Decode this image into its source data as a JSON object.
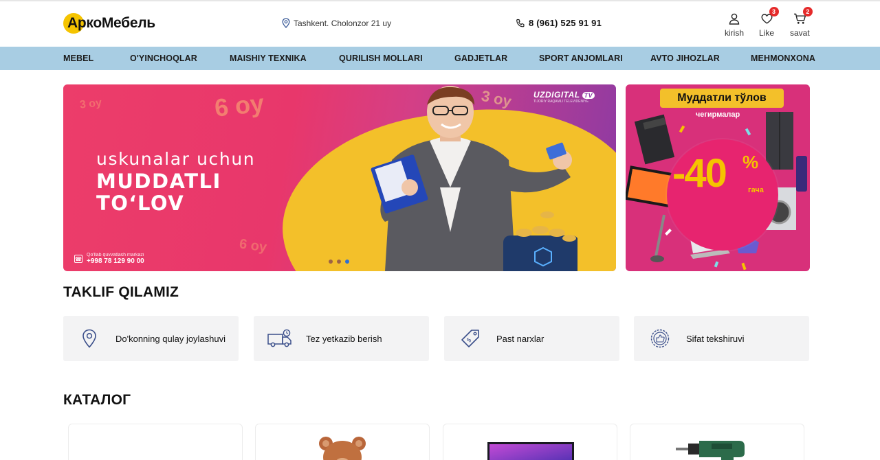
{
  "header": {
    "logo_text": "АркоМебель",
    "address": "Tashkent. Cholonzor 21 uy",
    "phone": "8 (961) 525 91 91",
    "account_label": "kirish",
    "like_label": "Like",
    "like_count": "3",
    "cart_label": "savat",
    "cart_count": "2"
  },
  "nav": {
    "items": [
      {
        "label": "MEBEL"
      },
      {
        "label": "O'YINCHOQLAR"
      },
      {
        "label": "MAISHIY TEXNIKA"
      },
      {
        "label": "QURILISH MOLLARI"
      },
      {
        "label": "GADJETLAR"
      },
      {
        "label": "SPORT ANJOMLARI"
      },
      {
        "label": "AVTO JIHOZLAR"
      },
      {
        "label": "MEHMONXONA"
      }
    ]
  },
  "banner": {
    "line1": "uskunalar uchun",
    "line2": "MUDDATLI",
    "line3": "TO‘LOV",
    "brand": "UZDIGITAL",
    "brand_tv": "TV",
    "brand_sub": "TIJORIY RAQAMLI TELEVIDENIYE",
    "support_label": "Qo'llab quvvatlash markazi",
    "support_phone": "+998 78 129 90 00",
    "deco_big": "6 oy",
    "deco_small": "3 oy",
    "slides_total": 3,
    "active_slide": 3
  },
  "side_banner": {
    "title": "Муддатли тўлов",
    "subtitle": "чегирмалар",
    "discount": "-40",
    "percent": "%",
    "suffix": "гача"
  },
  "offers": {
    "title": "TAKLIF QILAMIZ",
    "items": [
      {
        "label": "Do'konning qulay joylashuvi",
        "icon": "location-pin-icon"
      },
      {
        "label": "Tez yetkazib berish",
        "icon": "delivery-truck-icon"
      },
      {
        "label": "Past narxlar",
        "icon": "price-tag-icon"
      },
      {
        "label": "Sifat tekshiruvi",
        "icon": "quality-badge-icon"
      }
    ]
  },
  "catalog": {
    "title": "КАТАЛОГ",
    "items": [
      {
        "icon": "blank-product-icon"
      },
      {
        "icon": "teddy-bear-icon"
      },
      {
        "icon": "tv-screen-icon"
      },
      {
        "icon": "drill-icon"
      }
    ]
  },
  "colors": {
    "nav_bg": "#a8cde3",
    "accent_yellow": "#f5c400",
    "badge_red": "#e52a2a",
    "banner_pink": "#ec3d6a",
    "card_bg": "#f3f3f4"
  }
}
